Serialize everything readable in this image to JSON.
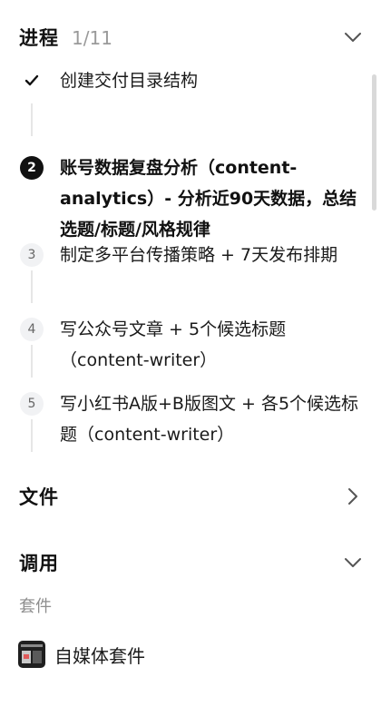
{
  "progress": {
    "title": "进程",
    "count": "1/11",
    "toggle_icon": "chevron-down-icon"
  },
  "steps": [
    {
      "marker": "✓",
      "state": "done",
      "text": "创建交付目录结构"
    },
    {
      "marker": "2",
      "state": "active",
      "text": "账号数据复盘分析（content-analytics）- 分析近90天数据，总结选题/标题/风格规律"
    },
    {
      "marker": "3",
      "state": "pending",
      "text": "制定多平台传播策略 + 7天发布排期"
    },
    {
      "marker": "4",
      "state": "pending",
      "text": "写公众号文章 + 5个候选标题（content-writer）"
    },
    {
      "marker": "5",
      "state": "pending",
      "text": "写小红书A版+B版图文 + 各5个候选标题（content-writer）"
    }
  ],
  "files": {
    "title": "文件",
    "toggle_icon": "chevron-right-icon"
  },
  "calls": {
    "title": "调用",
    "toggle_icon": "chevron-down-icon",
    "suite_label": "套件",
    "suite_item": "自媒体套件"
  }
}
